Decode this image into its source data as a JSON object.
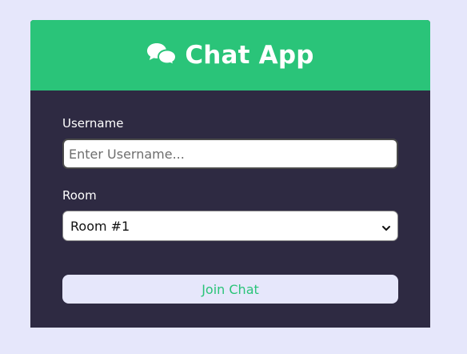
{
  "header": {
    "title": "Chat App",
    "icon": "comments-icon"
  },
  "form": {
    "username": {
      "label": "Username",
      "placeholder": "Enter Username...",
      "value": ""
    },
    "room": {
      "label": "Room",
      "selected": "Room #1"
    },
    "submit_label": "Join Chat"
  },
  "colors": {
    "page_background": "#e6e7fb",
    "header": "#2ac479",
    "card": "#2e2a42",
    "button_text": "#2ac479"
  }
}
